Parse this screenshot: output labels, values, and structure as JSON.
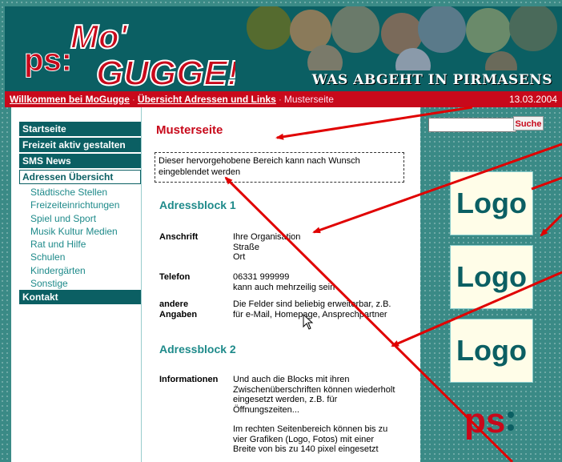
{
  "header": {
    "logo_text": "ps: Mo' Gugge!",
    "tagline": "WAS ABGEHT IN PIRMASENS"
  },
  "nav": {
    "crumb1": "Willkommen bei MoGugge",
    "sep1": "·",
    "crumb2": "Übersicht Adressen und Links",
    "sep2": "·",
    "current": "Musterseite",
    "date": "13.03.2004"
  },
  "menu": {
    "main": [
      "Startseite",
      "Freizeit aktiv gestalten",
      "SMS News",
      "Adressen Übersicht"
    ],
    "sub": [
      "Städtische Stellen",
      "Freizeiteinrichtungen",
      "Spiel und Sport",
      "Musik Kultur Medien",
      "Rat und Hilfe",
      "Schulen",
      "Kindergärten",
      "Sonstige"
    ],
    "last": "Kontakt"
  },
  "content": {
    "title": "Musterseite",
    "highlight": "Dieser hervorgehobene Bereich kann nach Wunsch eingeblendet werden",
    "block1_heading": "Adressblock 1",
    "anschrift_label": "Anschrift",
    "anschrift_lines": [
      "Ihre Organisation",
      "Straße",
      "Ort"
    ],
    "telefon_label": "Telefon",
    "telefon_lines": [
      "06331 999999",
      "kann auch mehrzeilig sein"
    ],
    "andere_label": "andere Angaben",
    "andere_lines": [
      "Die Felder sind beliebig erweiterbar, z.B.",
      "für e-Mail, Homepage, Ansprechpartner"
    ],
    "block2_heading": "Adressblock 2",
    "info_label": "Informationen",
    "info_p1": [
      "Und auch die Blocks mit ihren",
      "Zwischenüberschriften können wiederholt",
      "eingesetzt werden, z.B. für",
      "Öffnungszeiten..."
    ],
    "info_p2": [
      "Im rechten Seitenbereich können bis zu",
      "vier Grafiken (Logo, Fotos) mit einer",
      "Breite von bis zu 140 pixel eingesetzt"
    ]
  },
  "right": {
    "search_button": "Suche",
    "search_value": "",
    "logo_label": "Logo",
    "ps_label": "ps:"
  },
  "colors": {
    "teal": "#0b5f63",
    "red": "#c8091b",
    "link_teal": "#1e8a8a"
  }
}
